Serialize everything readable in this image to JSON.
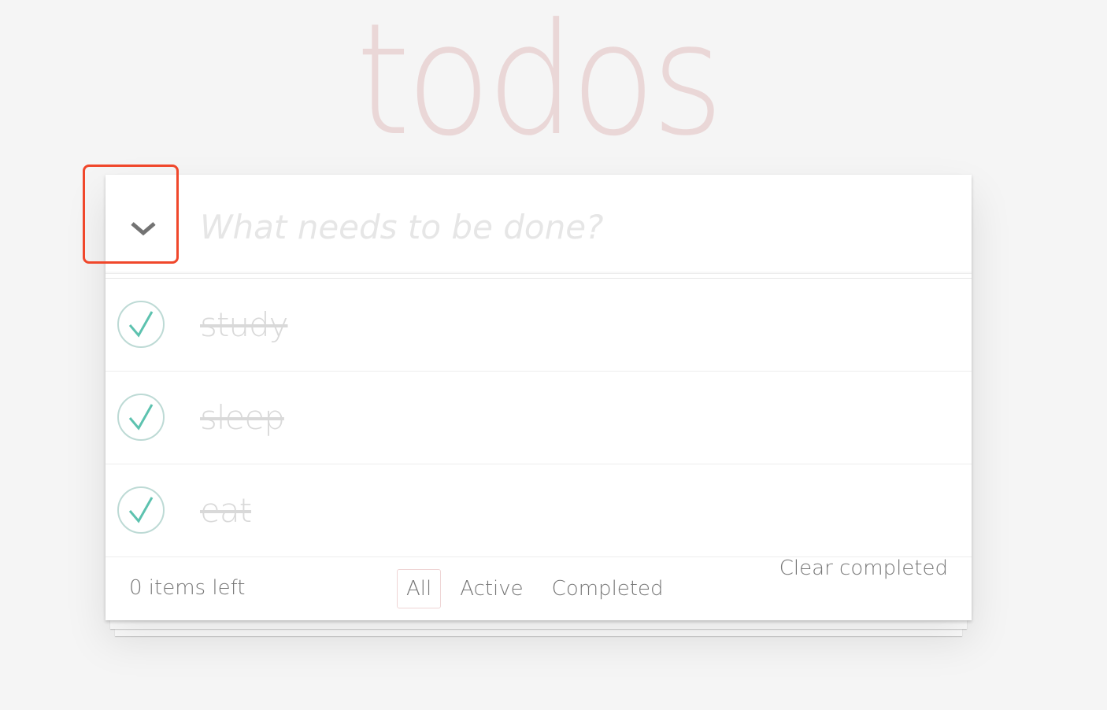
{
  "app": {
    "title": "todos"
  },
  "new_todo": {
    "value": "",
    "placeholder": "What needs to be done?"
  },
  "toggle_all": {
    "icon": "chevron-down-icon",
    "checked": true
  },
  "todos": [
    {
      "label": "study",
      "completed": true
    },
    {
      "label": "sleep",
      "completed": true
    },
    {
      "label": "eat",
      "completed": true
    }
  ],
  "footer": {
    "count_text": "0 items left",
    "filters": [
      {
        "label": "All",
        "selected": true
      },
      {
        "label": "Active",
        "selected": false
      },
      {
        "label": "Completed",
        "selected": false
      }
    ],
    "clear_label": "Clear completed"
  },
  "colors": {
    "title": "#ead7d7",
    "check_stroke": "#5dc2af",
    "check_circle": "#bddad5",
    "highlight": "#f0472b",
    "completed_text": "#d9d9d9"
  }
}
